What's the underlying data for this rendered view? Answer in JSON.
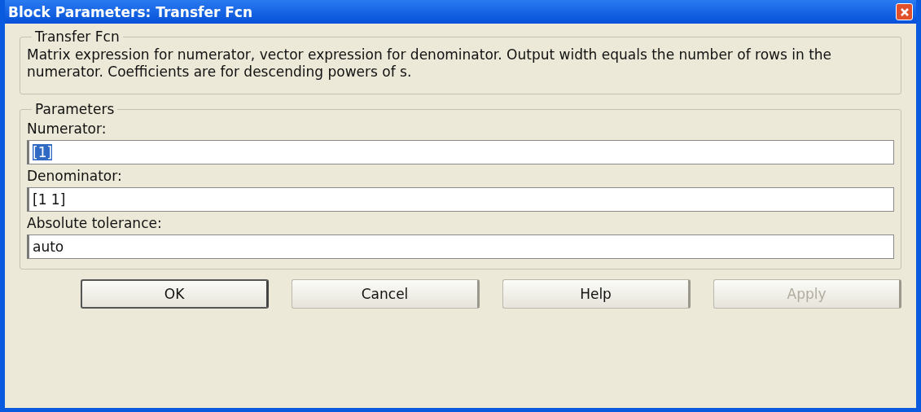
{
  "window": {
    "title": "Block Parameters: Transfer Fcn"
  },
  "description_group": {
    "title": "Transfer Fcn",
    "text": "Matrix expression for numerator, vector expression for denominator. Output width equals the number of rows in the numerator.  Coefficients are for descending powers of s."
  },
  "parameters_group": {
    "title": "Parameters",
    "fields": [
      {
        "label": "Numerator:",
        "value": "[1]",
        "selected": true
      },
      {
        "label": "Denominator:",
        "value": "[1 1]",
        "selected": false
      },
      {
        "label": "Absolute tolerance:",
        "value": "auto",
        "selected": false
      }
    ]
  },
  "buttons": [
    {
      "label": "OK",
      "default": true,
      "disabled": false
    },
    {
      "label": "Cancel",
      "default": false,
      "disabled": false
    },
    {
      "label": "Help",
      "default": false,
      "disabled": false
    },
    {
      "label": "Apply",
      "default": false,
      "disabled": true
    }
  ]
}
